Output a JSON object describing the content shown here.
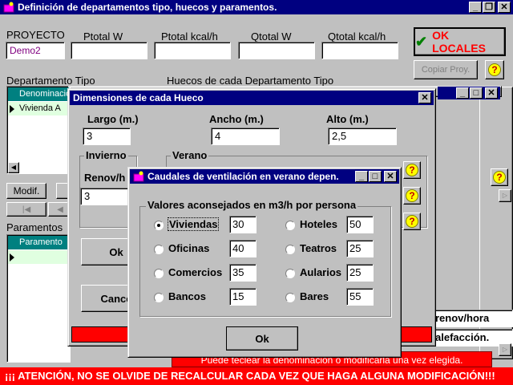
{
  "main": {
    "title": "Definición de departamentos tipo,  huecos y paramentos.",
    "proyecto_label": "PROYECTO",
    "proyecto_value": "Demo2",
    "ptotal_w_label": "Ptotal W",
    "ptotal_kcal_label": "Ptotal kcal/h",
    "qtotal_w_label": "Qtotal W",
    "qtotal_kcal_label": "Qtotal kcal/h",
    "ok_locales": "OK LOCALES",
    "copiar_proy": "Copiar Proy.",
    "departamento_tipo_label": "Departamento Tipo",
    "huecos_label": "Huecos de cada Departamento Tipo",
    "denominacion_header": "Denominació",
    "vivienda_row": "Vivienda A",
    "modif_button": "Modif.",
    "paramentos_label": "Paramentos",
    "parametro_header": "Paramento",
    "renov_hora": "renov/hora",
    "calefaccion": "alefacción.",
    "aviso_rojo": "Puede teclear la denominación o modificarla una vez elegida.",
    "warning": "¡¡¡ ATENCIÓN, NO SE OLVIDE DE RECALCULAR CADA VEZ QUE HAGA ALGUNA MODIFICACIÓN!!!"
  },
  "dims": {
    "title": "Dimensiones de cada Hueco",
    "largo_label": "Largo (m.)",
    "largo_value": "3",
    "ancho_label": "Ancho (m.)",
    "ancho_value": "4",
    "alto_label": "Alto (m.)",
    "alto_value": "2,5",
    "invierno_label": "Invierno",
    "renov_label": "Renov/h",
    "renov_value": "3",
    "verano_label": "Verano",
    "ok_button": "Ok",
    "cancel_button": "Cance"
  },
  "caudales": {
    "title": "Caudales de ventilación en verano depen.",
    "group_label": "Valores aconsejados en m3/h por persona",
    "options_left": [
      {
        "label": "Viviendas",
        "value": "30",
        "selected": true
      },
      {
        "label": "Oficinas",
        "value": "40",
        "selected": false
      },
      {
        "label": "Comercios",
        "value": "35",
        "selected": false
      },
      {
        "label": "Bancos",
        "value": "15",
        "selected": false
      }
    ],
    "options_right": [
      {
        "label": "Hoteles",
        "value": "50",
        "selected": false
      },
      {
        "label": "Teatros",
        "value": "25",
        "selected": false
      },
      {
        "label": "Aularios",
        "value": "25",
        "selected": false
      },
      {
        "label": "Bares",
        "value": "55",
        "selected": false
      }
    ],
    "ok_button": "Ok"
  },
  "icons": {
    "help": "question-icon",
    "ok": "check-icon",
    "app": "app-icon"
  },
  "colors": {
    "titlebar": "#000080",
    "warning_bg": "#ff0000",
    "ok_text": "#ff0000"
  }
}
